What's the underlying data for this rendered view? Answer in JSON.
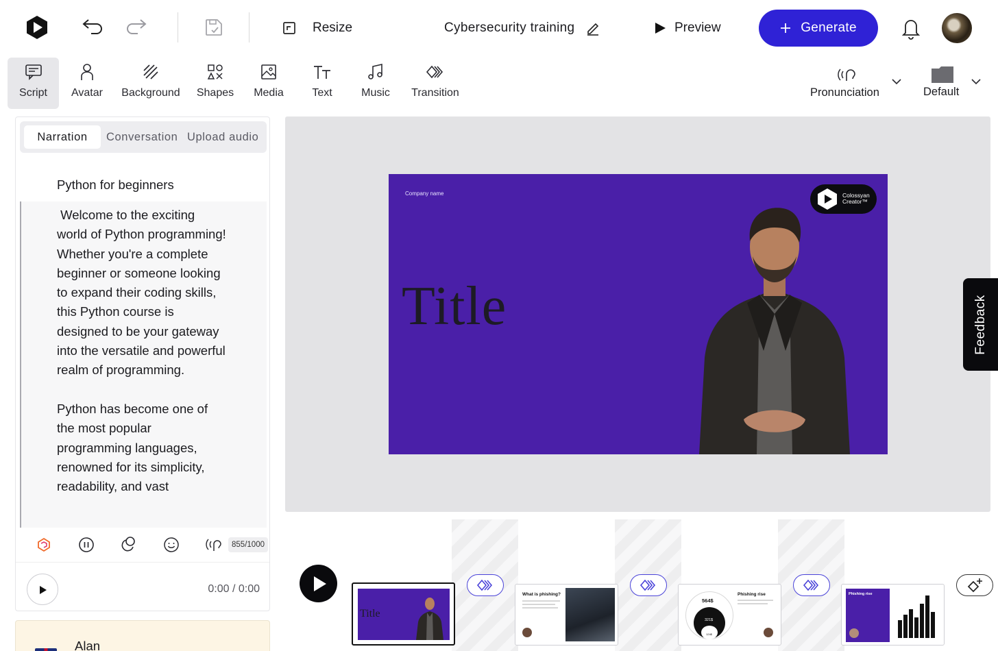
{
  "header": {
    "resize_label": "Resize",
    "project_title": "Cybersecurity training",
    "preview_label": "Preview",
    "generate_label": "Generate",
    "colors": {
      "generate_bg": "#2f22d6",
      "accent_purple": "#4a1fa8"
    }
  },
  "toolbar": {
    "items": [
      {
        "label": "Script",
        "icon": "script-icon"
      },
      {
        "label": "Avatar",
        "icon": "avatar-icon"
      },
      {
        "label": "Background",
        "icon": "background-icon"
      },
      {
        "label": "Shapes",
        "icon": "shapes-icon"
      },
      {
        "label": "Media",
        "icon": "media-icon"
      },
      {
        "label": "Text",
        "icon": "text-icon"
      },
      {
        "label": "Music",
        "icon": "music-icon"
      },
      {
        "label": "Transition",
        "icon": "transition-icon"
      }
    ],
    "pronunciation_label": "Pronunciation",
    "default_label": "Default"
  },
  "script_panel": {
    "tabs": [
      "Narration",
      "Conversation",
      "Upload audio"
    ],
    "title": "Python for beginners",
    "body": " Welcome to the exciting world of Python programming! Whether you're a complete beginner or someone looking to expand their coding skills, this Python course is designed to be your gateway into the versatile and powerful realm of programming.\n\nPython has become one of the most popular programming languages, renowned for its simplicity, readability, and vast",
    "char_count": "855/1000",
    "time": "0:00 / 0:00",
    "avatar_name": "Alan"
  },
  "slide": {
    "company": "Company name",
    "title": "Title",
    "logo_text_line1": "Colossyan",
    "logo_text_line2": "Creator™"
  },
  "feedback_label": "Feedback",
  "timeline": {
    "thumb1_title": "Title",
    "thumb2_title": "What is phishing?",
    "thumb3_title": "Phishing rise",
    "thumb3_val1": "564$",
    "thumb3_val2": "321$",
    "thumb3_val3": "124$",
    "thumb4_title": "Phishing rise"
  }
}
